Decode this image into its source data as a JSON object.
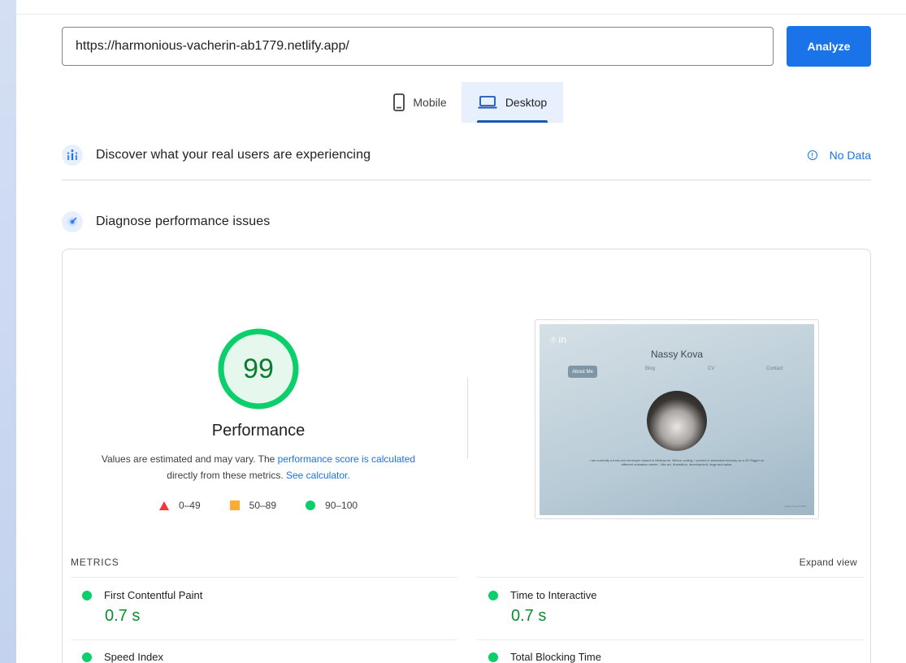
{
  "url_bar": {
    "value": "https://harmonious-vacherin-ab1779.netlify.app/",
    "analyze_label": "Analyze"
  },
  "tabs": [
    {
      "label": "Mobile",
      "icon": "phone-icon",
      "selected": false
    },
    {
      "label": "Desktop",
      "icon": "laptop-icon",
      "selected": true
    }
  ],
  "discover": {
    "title": "Discover what your real users are experiencing",
    "status": "No Data",
    "icon": "users-chart-icon"
  },
  "diagnose": {
    "title": "Diagnose performance issues",
    "icon": "lighthouse-icon"
  },
  "performance": {
    "score": "99",
    "score_fraction": 0.99,
    "label": "Performance",
    "desc_prefix": "Values are estimated and may vary. The ",
    "desc_link1": "performance score is calculated",
    "desc_middle": "directly from these metrics. ",
    "desc_link2": "See calculator.",
    "legend": [
      {
        "range": "0–49",
        "shape": "triangle",
        "color": "#ff3333"
      },
      {
        "range": "50–89",
        "shape": "square",
        "color": "#ffaa33"
      },
      {
        "range": "90–100",
        "shape": "circle",
        "color": "#0cce6b"
      }
    ]
  },
  "screenshot": {
    "social": "⌾ in",
    "name": "Nassy Kova",
    "nav": [
      "About Me",
      "Blog",
      "CV",
      "Contact"
    ],
    "bio": "I am currently a front-end developer based in Melbourne. Before coding, I worked in animation industry as a 2D Rigger on different animation series. I like art, illustration, development, dogs and salsa.",
    "footer": "Nassy Kova © 2023"
  },
  "metrics": {
    "heading": "METRICS",
    "expand_label": "Expand view",
    "items": [
      {
        "name": "First Contentful Paint",
        "value": "0.7 s"
      },
      {
        "name": "Time to Interactive",
        "value": "0.7 s"
      },
      {
        "name": "Speed Index",
        "value": ""
      },
      {
        "name": "Total Blocking Time",
        "value": ""
      }
    ]
  }
}
